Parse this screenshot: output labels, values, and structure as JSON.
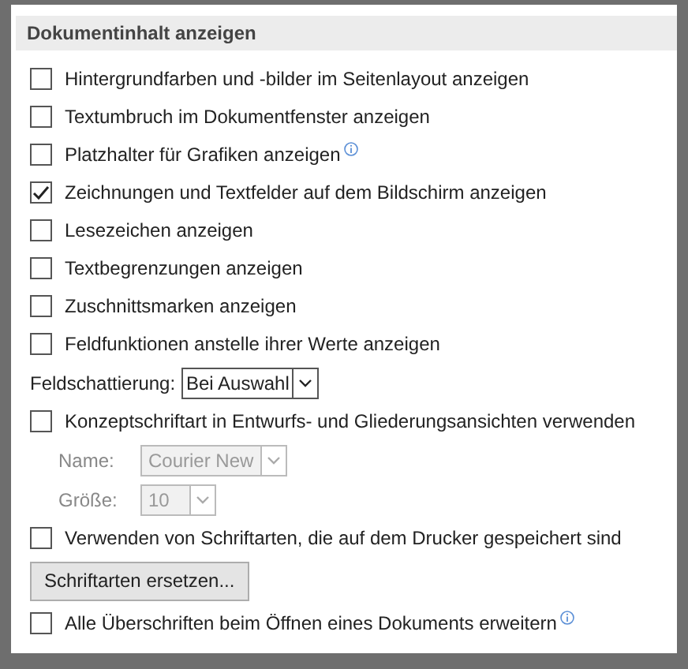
{
  "section": {
    "title": "Dokumentinhalt anzeigen"
  },
  "items": [
    {
      "kind": "checkbox",
      "label": "Hintergrundfarben und -bilder im Seitenlayout anzeigen",
      "checked": false,
      "info": false
    },
    {
      "kind": "checkbox",
      "label": "Textumbruch im Dokumentfenster anzeigen",
      "checked": false,
      "info": false
    },
    {
      "kind": "checkbox",
      "label": "Platzhalter für Grafiken anzeigen",
      "checked": false,
      "info": true
    },
    {
      "kind": "checkbox",
      "label": "Zeichnungen und Textfelder auf dem Bildschirm anzeigen",
      "checked": true,
      "info": false
    },
    {
      "kind": "checkbox",
      "label": "Lesezeichen anzeigen",
      "checked": false,
      "info": false
    },
    {
      "kind": "checkbox",
      "label": "Textbegrenzungen anzeigen",
      "checked": false,
      "info": false
    },
    {
      "kind": "checkbox",
      "label": "Zuschnittsmarken anzeigen",
      "checked": false,
      "info": false
    },
    {
      "kind": "checkbox",
      "label": "Feldfunktionen anstelle ihrer Werte anzeigen",
      "checked": false,
      "info": false
    },
    {
      "kind": "select",
      "label": "Feldschattierung:",
      "value": "Bei Auswahl",
      "disabled": false
    },
    {
      "kind": "checkbox",
      "label": "Konzeptschriftart in Entwurfs- und Gliederungsansichten verwenden",
      "checked": false,
      "info": false
    },
    {
      "kind": "select",
      "label": "Name:",
      "value": "Courier New",
      "disabled": true
    },
    {
      "kind": "select",
      "label": "Größe:",
      "value": "10",
      "disabled": true
    },
    {
      "kind": "checkbox",
      "label": "Verwenden von Schriftarten, die auf dem Drucker gespeichert sind",
      "checked": false,
      "info": false
    },
    {
      "kind": "button",
      "label": "Schriftarten ersetzen..."
    },
    {
      "kind": "checkbox",
      "label": "Alle Überschriften beim Öffnen eines Dokuments erweitern",
      "checked": false,
      "info": true
    }
  ]
}
